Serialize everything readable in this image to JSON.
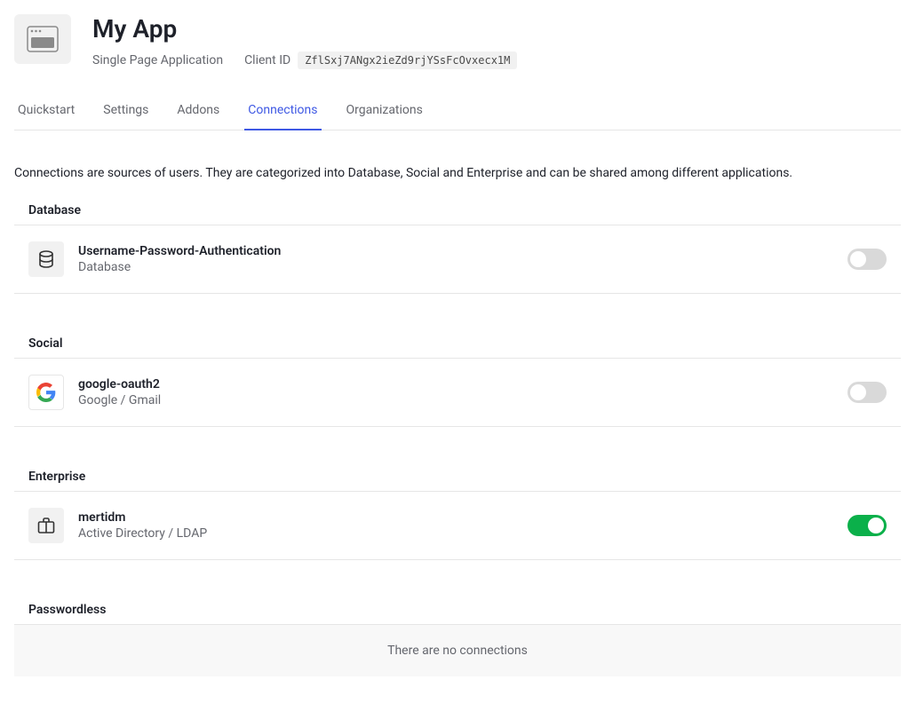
{
  "header": {
    "title": "My App",
    "appType": "Single Page Application",
    "clientIdLabel": "Client ID",
    "clientIdValue": "ZflSxj7ANgx2ieZd9rjYSsFcOvxecx1M"
  },
  "tabs": [
    {
      "label": "Quickstart",
      "active": false
    },
    {
      "label": "Settings",
      "active": false
    },
    {
      "label": "Addons",
      "active": false
    },
    {
      "label": "Connections",
      "active": true
    },
    {
      "label": "Organizations",
      "active": false
    }
  ],
  "intro": "Connections are sources of users. They are categorized into Database, Social and Enterprise and can be shared among different applications.",
  "sections": {
    "database": {
      "heading": "Database",
      "items": [
        {
          "name": "Username-Password-Authentication",
          "type": "Database",
          "enabled": false
        }
      ]
    },
    "social": {
      "heading": "Social",
      "items": [
        {
          "name": "google-oauth2",
          "type": "Google / Gmail",
          "enabled": false
        }
      ]
    },
    "enterprise": {
      "heading": "Enterprise",
      "items": [
        {
          "name": "mertidm",
          "type": "Active Directory / LDAP",
          "enabled": true
        }
      ]
    },
    "passwordless": {
      "heading": "Passwordless",
      "empty": "There are no connections"
    }
  }
}
